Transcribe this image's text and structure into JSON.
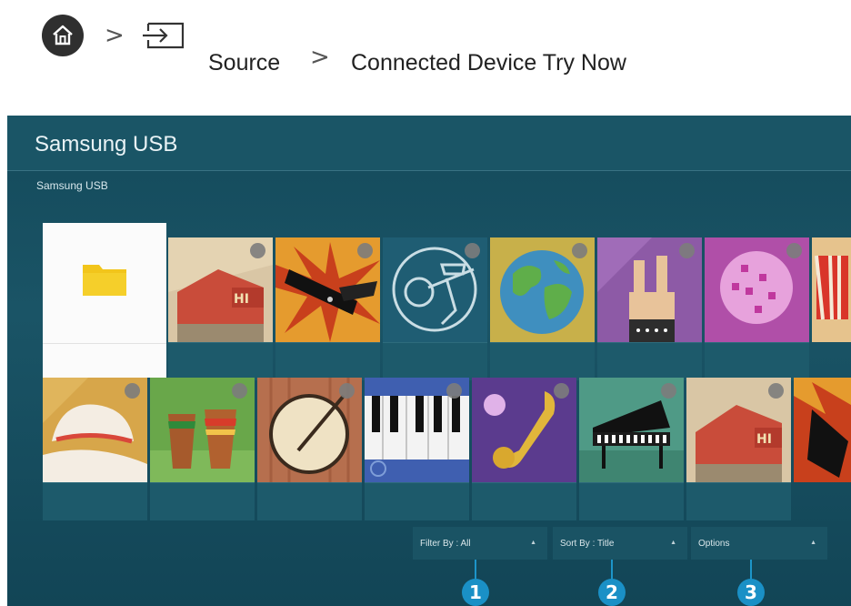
{
  "breadcrumb": {
    "sep1": ">",
    "sep2": ">",
    "source_label": "Source",
    "device_label": "Connected Device Try Now"
  },
  "panel": {
    "title": "Samsung USB",
    "subtitle": "Samsung USB"
  },
  "toolbar": {
    "filter_label": "Filter By : All",
    "sort_label": "Sort By : Title",
    "options_label": "Options",
    "dropdown_glyph": "▲"
  },
  "callouts": [
    "1",
    "2",
    "3"
  ],
  "colors": {
    "panel_bg": "#1a5466",
    "callout_blue": "#1a90c6",
    "folder_yellow": "#f2c51b"
  },
  "icons": {
    "home": "home-icon",
    "source": "source-input-icon",
    "folder": "folder-icon"
  }
}
